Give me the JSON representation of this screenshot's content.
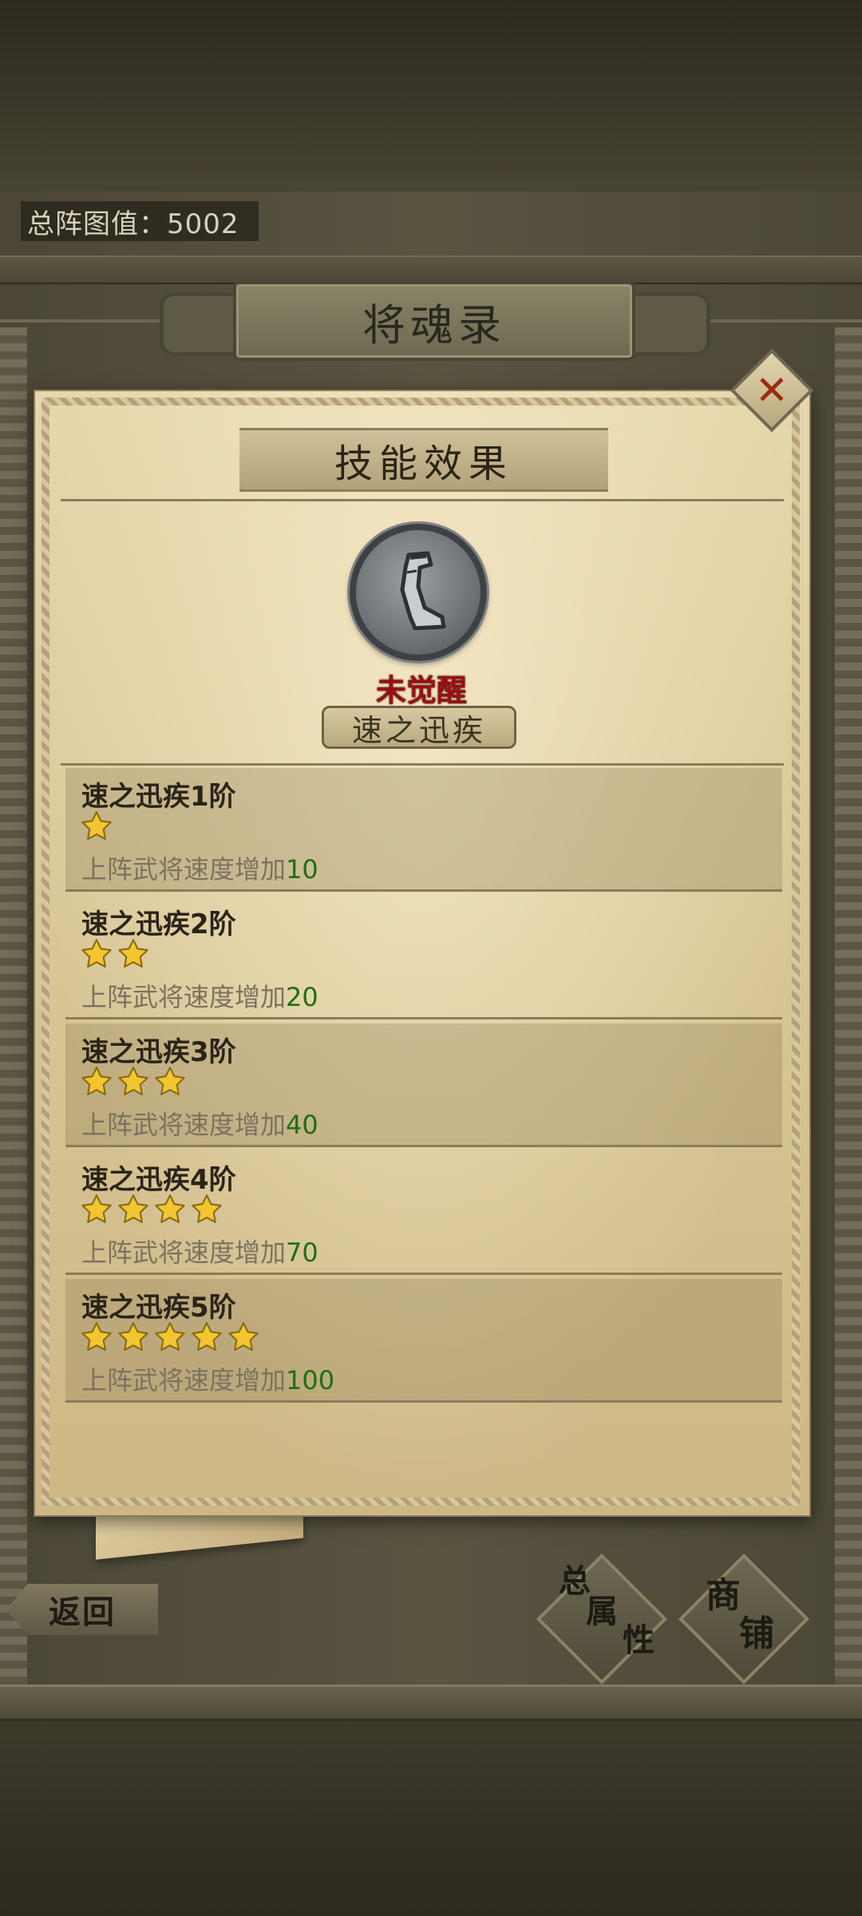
{
  "header": {
    "total_value": "总阵图值：5002"
  },
  "window": {
    "title": "将魂录"
  },
  "panel": {
    "title": "技能效果",
    "skill_status": "未觉醒",
    "skill_name": "速之迅疾",
    "levels": [
      {
        "title": "速之迅疾1阶",
        "stars": 1,
        "desc": "上阵武将速度增加",
        "value": "10"
      },
      {
        "title": "速之迅疾2阶",
        "stars": 2,
        "desc": "上阵武将速度增加",
        "value": "20"
      },
      {
        "title": "速之迅疾3阶",
        "stars": 3,
        "desc": "上阵武将速度增加",
        "value": "40"
      },
      {
        "title": "速之迅疾4阶",
        "stars": 4,
        "desc": "上阵武将速度增加",
        "value": "70"
      },
      {
        "title": "速之迅疾5阶",
        "stars": 5,
        "desc": "上阵武将速度增加",
        "value": "100"
      }
    ]
  },
  "footer": {
    "back_label": "返回",
    "attributes_label_1": "总",
    "attributes_label_2": "属",
    "attributes_label_3": "性",
    "shop_label_1": "商",
    "shop_label_2": "铺"
  },
  "icons": {
    "close": "close-icon",
    "skill": "leg-icon",
    "star": "star-icon"
  },
  "colors": {
    "status_red": "#9b0f0f",
    "value_green": "#1f6f13",
    "star_gold": "#f2c531"
  }
}
